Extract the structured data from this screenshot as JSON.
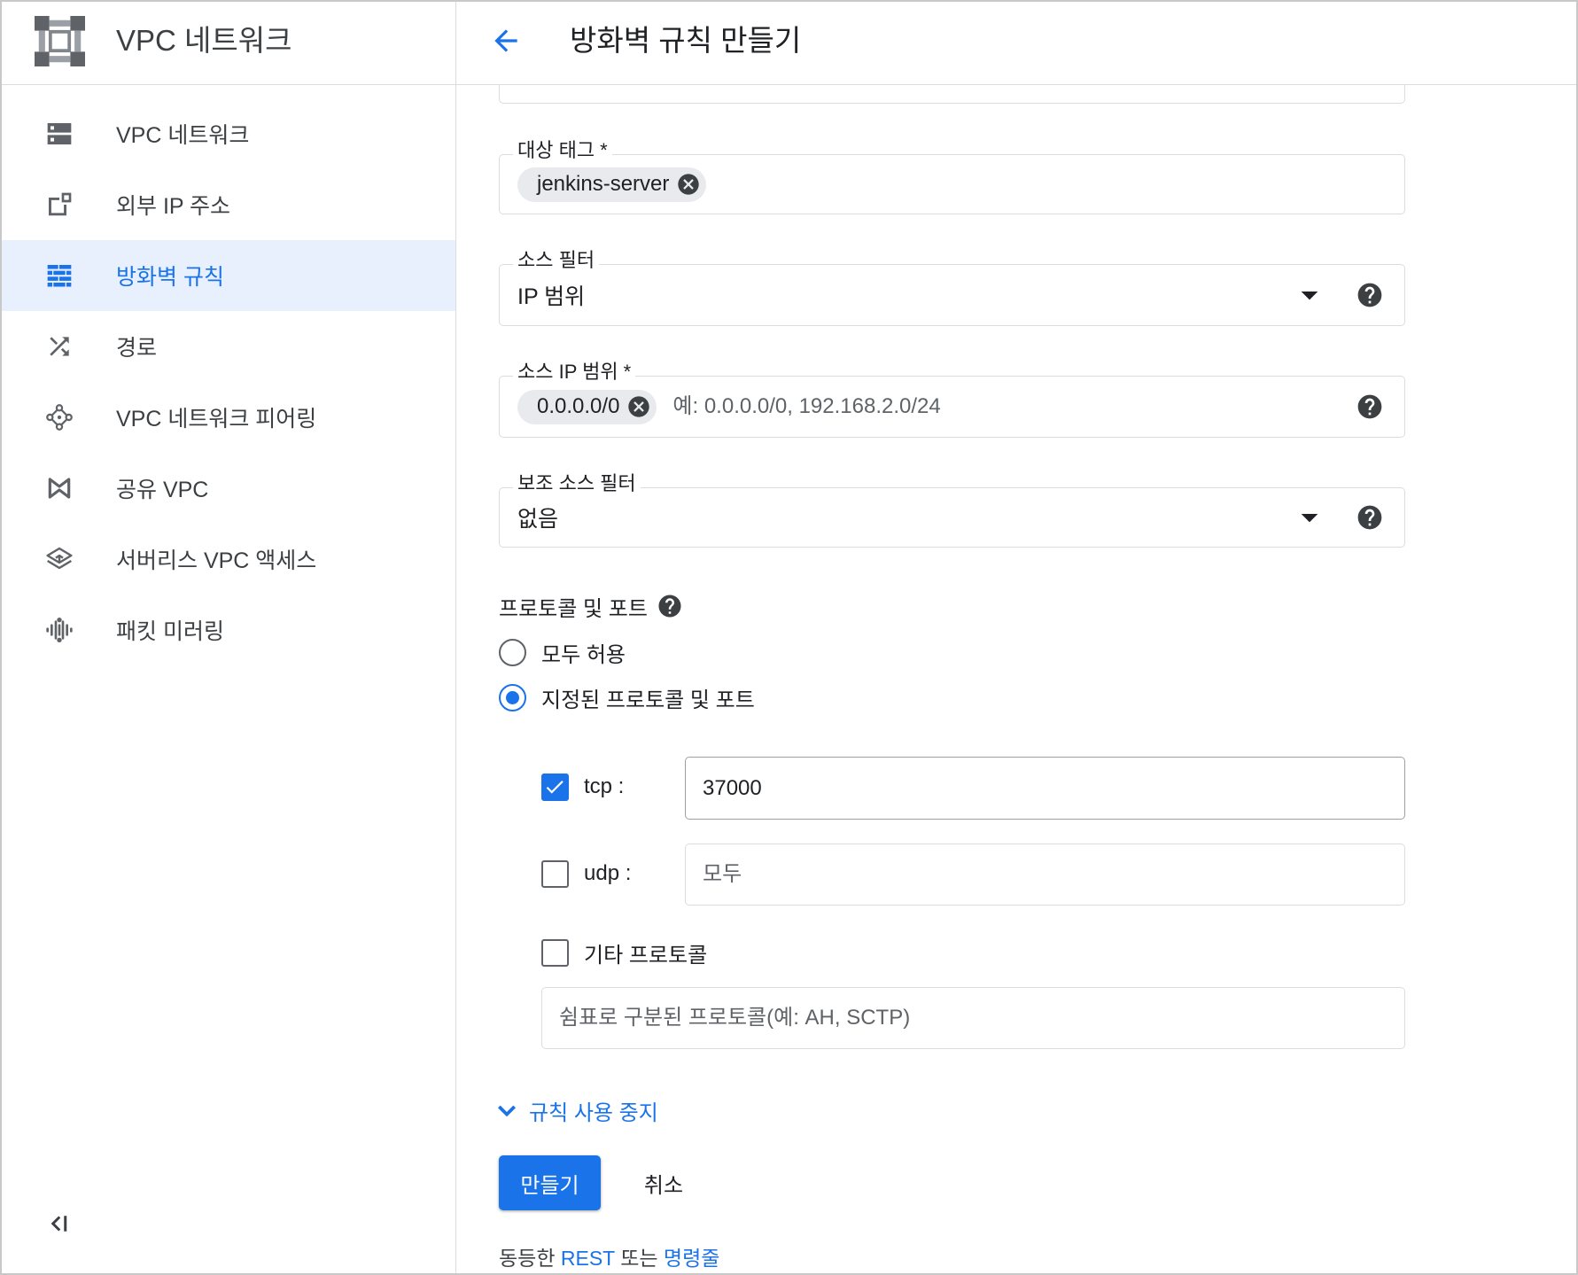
{
  "colors": {
    "accent": "#1a73e8",
    "active_bg": "#e8f0fe",
    "text": "#202124",
    "muted": "#5f6368",
    "border": "#dadce0",
    "chip_bg": "#e8eaed"
  },
  "sidebar": {
    "logo_icon": "vpc-logo-icon",
    "title": "VPC 네트워크",
    "items": [
      {
        "label": "VPC 네트워크",
        "icon": "vpc-network-icon",
        "active": false
      },
      {
        "label": "외부 IP 주소",
        "icon": "external-ip-icon",
        "active": false
      },
      {
        "label": "방화벽 규칙",
        "icon": "firewall-icon",
        "active": true
      },
      {
        "label": "경로",
        "icon": "routes-icon",
        "active": false
      },
      {
        "label": "VPC 네트워크 피어링",
        "icon": "peering-icon",
        "active": false
      },
      {
        "label": "공유 VPC",
        "icon": "shared-vpc-icon",
        "active": false
      },
      {
        "label": "서버리스 VPC 액세스",
        "icon": "serverless-vpc-access-icon",
        "active": false
      },
      {
        "label": "패킷 미러링",
        "icon": "packet-mirroring-icon",
        "active": false
      }
    ],
    "collapse_icon": "collapse-sidebar-icon"
  },
  "header": {
    "back_icon": "arrow-back-icon",
    "title": "방화벽 규칙 만들기"
  },
  "form": {
    "target_tags": {
      "label": "대상 태그 *",
      "chips": [
        "jenkins-server"
      ]
    },
    "source_filter": {
      "label": "소스 필터",
      "value": "IP 범위"
    },
    "source_ip_ranges": {
      "label": "소스 IP 범위 *",
      "chips": [
        "0.0.0.0/0"
      ],
      "placeholder": "예: 0.0.0.0/0, 192.168.2.0/24"
    },
    "secondary_source_filter": {
      "label": "보조 소스 필터",
      "value": "없음"
    },
    "protocols": {
      "heading": "프로토콜 및 포트",
      "options": [
        {
          "label": "모두 허용",
          "selected": false
        },
        {
          "label": "지정된 프로토콜 및 포트",
          "selected": true
        }
      ],
      "tcp": {
        "label": "tcp :",
        "checked": true,
        "value": "37000"
      },
      "udp": {
        "label": "udp :",
        "checked": false,
        "placeholder": "모두"
      },
      "other": {
        "label": "기타 프로토콜",
        "checked": false,
        "placeholder": "쉼표로 구분된 프로토콜(예: AH, SCTP)"
      }
    },
    "disable_rule_label": "규칙 사용 중지",
    "create_label": "만들기",
    "cancel_label": "취소"
  },
  "footer": {
    "prefix": "동등한",
    "rest_link": "REST",
    "conjunction": "또는",
    "command_line_link": "명령줄"
  }
}
